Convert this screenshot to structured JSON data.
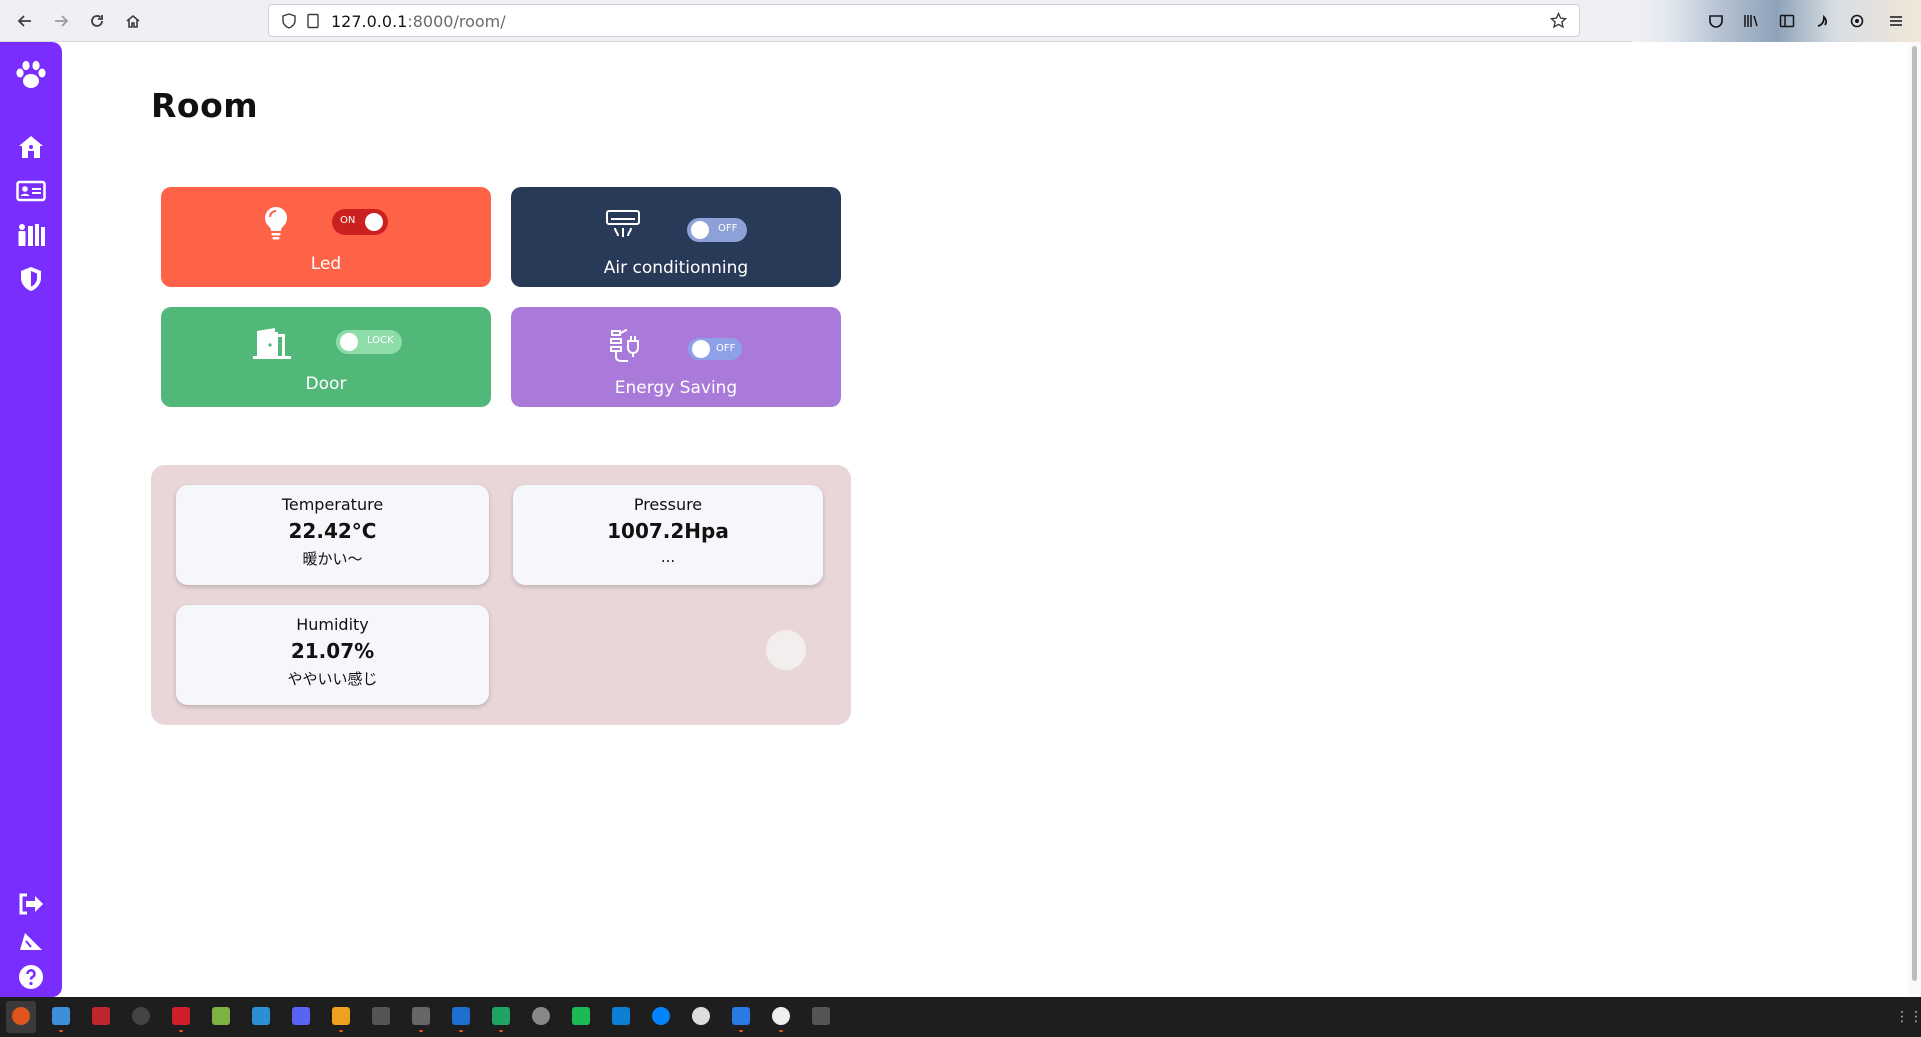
{
  "browser": {
    "url_host": "127.0.0.1",
    "url_rest": ":8000/room/"
  },
  "page": {
    "title": "Room"
  },
  "devices": [
    {
      "label": "Led",
      "icon": "lightbulb-icon",
      "state": "ON",
      "color": "#ff6347",
      "toggle_color": "#cc1f1f"
    },
    {
      "label": "Air conditionning",
      "icon": "air-conditioner-icon",
      "state": "OFF",
      "color": "#283a58",
      "toggle_color": "#8ea0d8"
    },
    {
      "label": "Door",
      "icon": "door-icon",
      "state": "LOCK",
      "color": "#52b87a",
      "toggle_color": "#8fdcab"
    },
    {
      "label": "Energy Saving",
      "icon": "plant-plug-icon",
      "state": "OFF",
      "color": "#a97ad9",
      "toggle_color": "#8ea0e8"
    }
  ],
  "sensors": {
    "temperature": {
      "name": "Temperature",
      "value": "22.42°C",
      "note": "暖かい～"
    },
    "pressure": {
      "name": "Pressure",
      "value": "1007.2Hpa",
      "note": "..."
    },
    "humidity": {
      "name": "Humidity",
      "value": "21.07%",
      "note": "ややいい感じ"
    }
  },
  "sidebar": {
    "top_icons": [
      "paw-icon"
    ],
    "nav_icons": [
      "house-icon",
      "id-card-icon",
      "people-icon",
      "shield-icon"
    ],
    "bottom_icons": [
      "logout-icon",
      "send-icon",
      "help-icon"
    ]
  },
  "colors": {
    "sidebar": "#7a2dff",
    "sensor_panel": "#e8d6d8"
  }
}
